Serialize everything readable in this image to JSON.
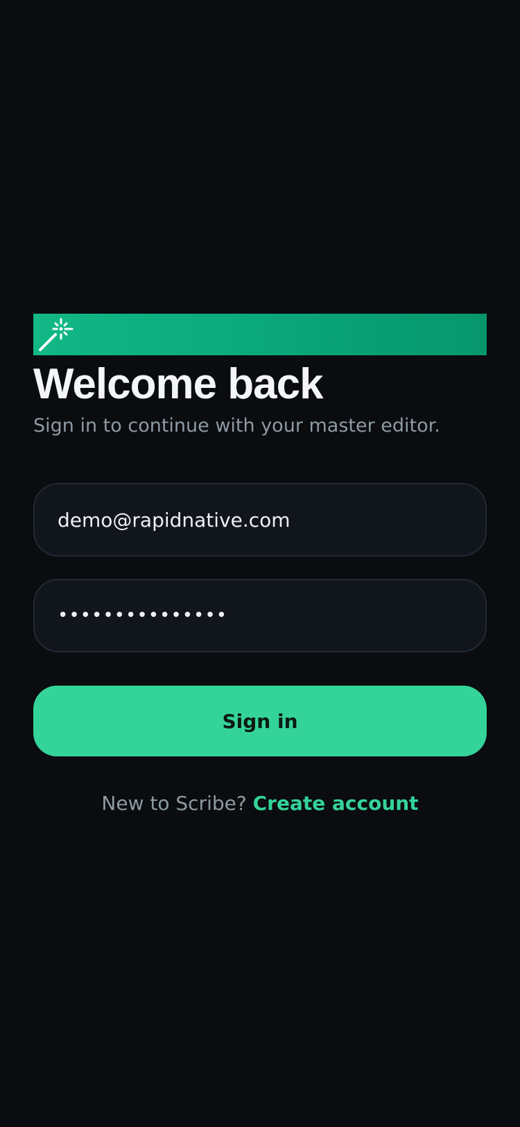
{
  "banner": {
    "icon": "magic-wand-icon",
    "gradient_start": "#12b886",
    "gradient_end": "#07966c"
  },
  "header": {
    "title": "Welcome back",
    "subtitle": "Sign in to continue with your master editor."
  },
  "form": {
    "email_value": "demo@rapidnative.com",
    "password_value": "•••••••••••••••"
  },
  "actions": {
    "signin_label": "Sign in"
  },
  "footer": {
    "prompt": "New to Scribe?",
    "link_label": "Create account"
  },
  "colors": {
    "background": "#0a0c0f",
    "accent": "#34d399",
    "field_bg": "#11151c",
    "muted_text": "#8f9aa3"
  }
}
